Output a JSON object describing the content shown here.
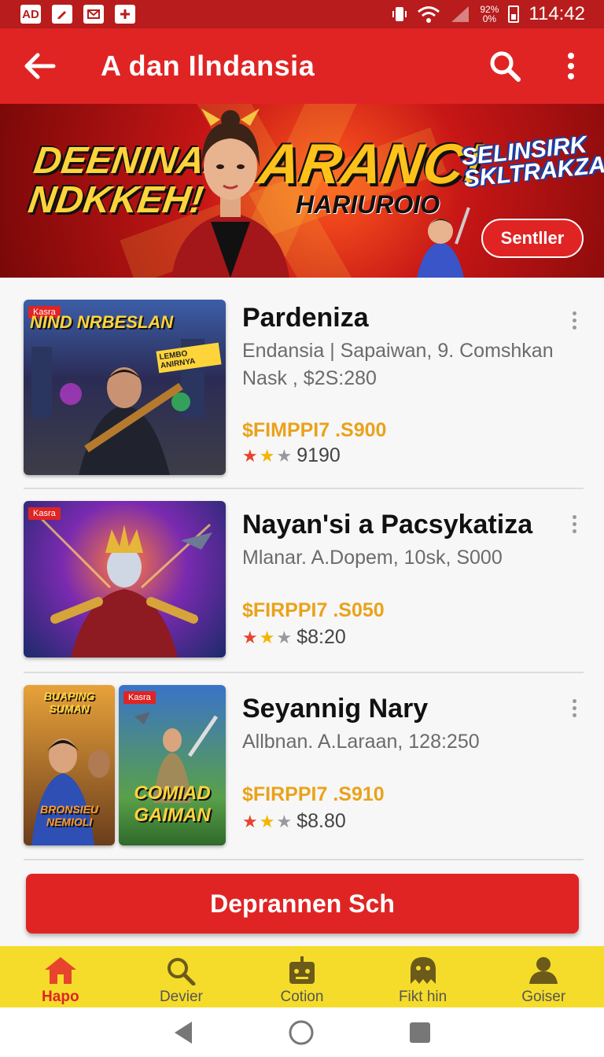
{
  "status_bar": {
    "left_icons": [
      "AD",
      "pencil",
      "mail",
      "plus"
    ],
    "battery_pct": "92%",
    "battery_sub": "0%",
    "time": "114:42"
  },
  "app_bar": {
    "title": "A dan Ilndansia",
    "back_icon": "arrow-left-icon",
    "search_icon": "search-icon",
    "more_icon": "more-vertical-icon"
  },
  "banner": {
    "headline_left": "DEENINAN NDKKEH!",
    "headline_main": "ARANC!",
    "subline": "HARIUROIO",
    "logo": "SELINSIRK SKLTRAKZAN",
    "button": "Sentller"
  },
  "items": [
    {
      "tag": "Kasra",
      "thumb_title": "NIND NRBESLAN",
      "thumb_sticker": "LEMBO ANIRNYA",
      "title": "Pardeniza",
      "meta1": "Endansia | Sapaiwan, 9. Comshkan",
      "meta2": "Nask , $2S:280",
      "price": "$FIMPPI7 .S900",
      "rating": "9190"
    },
    {
      "tag": "Kasra",
      "title": "Nayan'si a Pacsykatiza",
      "meta1": "Mlanar. A.Dopem, 10sk, S000",
      "price": "$FIRPPI7 .S050",
      "rating": "$8:20"
    },
    {
      "tag": "Kasra",
      "thumb_title_a": "BUAPING SUMAN",
      "thumb_caption_a": "BRONSIEU NEMIOLI",
      "thumb_title_b": "COMIAD GAIMAN",
      "title": "Seyannig Nary",
      "meta1": "Allbnan. A.Laraan, 128:250",
      "price": "$FIRPPI7 .S910",
      "rating": "$8.80"
    }
  ],
  "cta": {
    "label": "Deprannen Sch"
  },
  "bottom_nav": [
    {
      "label": "Hapo",
      "icon": "home-icon"
    },
    {
      "label": "Devier",
      "icon": "search-icon"
    },
    {
      "label": "Cotion",
      "icon": "robot-icon"
    },
    {
      "label": "Fikt hin",
      "icon": "ghost-icon"
    },
    {
      "label": "Goiser",
      "icon": "person-icon"
    }
  ],
  "colors": {
    "primary_red": "#e02424",
    "status_red": "#b81c1c",
    "nav_yellow": "#f5dc2a",
    "price_gold": "#eaa21a",
    "star_red": "#e8432d",
    "star_gold": "#f4b400"
  }
}
